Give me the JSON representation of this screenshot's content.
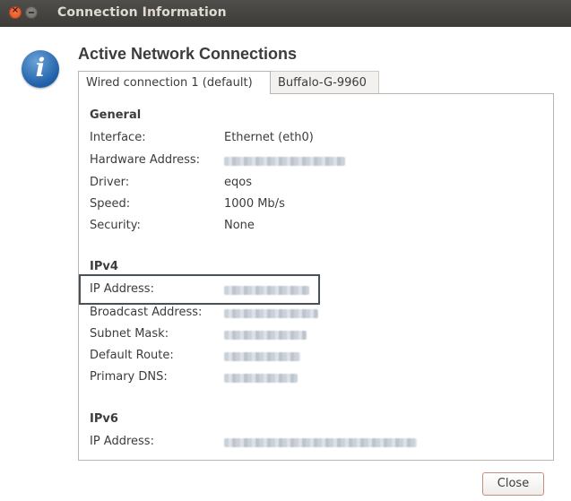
{
  "window": {
    "title": "Connection Information"
  },
  "heading": "Active Network Connections",
  "tabs": [
    {
      "label": "Wired connection 1 (default)",
      "active": true
    },
    {
      "label": "Buffalo-G-9960",
      "active": false
    }
  ],
  "general": {
    "title": "General",
    "rows": [
      {
        "label": "Interface:",
        "value": "Ethernet (eth0)"
      },
      {
        "label": "Hardware Address:",
        "value": ""
      },
      {
        "label": "Driver:",
        "value": "eqos"
      },
      {
        "label": "Speed:",
        "value": "1000 Mb/s"
      },
      {
        "label": "Security:",
        "value": "None"
      }
    ]
  },
  "ipv4": {
    "title": "IPv4",
    "rows": [
      {
        "label": "IP Address:",
        "value": ""
      },
      {
        "label": "Broadcast Address:",
        "value": ""
      },
      {
        "label": "Subnet Mask:",
        "value": ""
      },
      {
        "label": "Default Route:",
        "value": ""
      },
      {
        "label": "Primary DNS:",
        "value": ""
      }
    ]
  },
  "ipv6": {
    "title": "IPv6",
    "rows": [
      {
        "label": "IP Address:",
        "value": ""
      }
    ]
  },
  "buttons": {
    "close": "Close"
  },
  "colors": {
    "titlebar": "#3c3b37",
    "close_window": "#e0501e",
    "info_icon": "#1f5fa8",
    "highlight_border": "#4a5058"
  },
  "icons": {
    "info": "info-icon",
    "close_window": "close-icon",
    "minimize_window": "minimize-icon"
  }
}
